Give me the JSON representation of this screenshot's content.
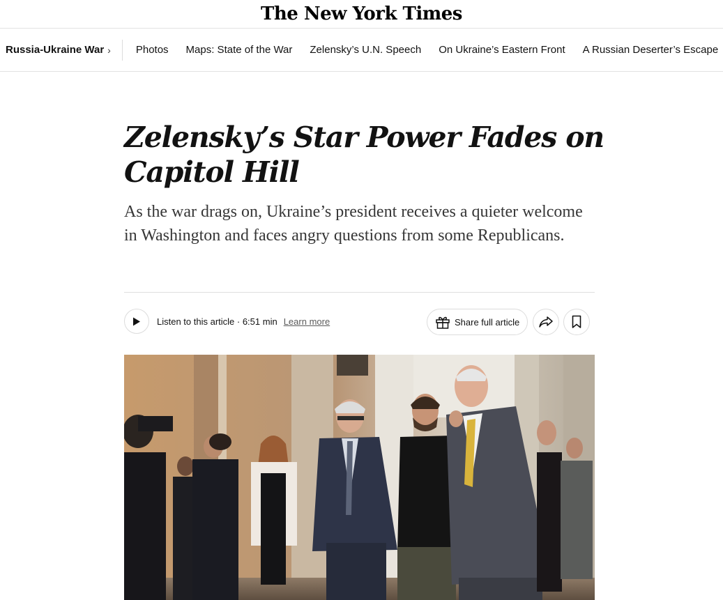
{
  "masthead": {
    "logo_text": "The New York Times"
  },
  "nav": {
    "section_label": "Russia-Ukraine War",
    "chevron": "›",
    "links": [
      "Photos",
      "Maps: State of the War",
      "Zelensky’s U.N. Speech",
      "On Ukraine’s Eastern Front",
      "A Russian Deserter’s Escape"
    ]
  },
  "article": {
    "headline": "Zelensky’s Star Power Fades on Capitol Hill",
    "summary": "As the war drags on, Ukraine’s president receives a quieter welcome in Washington and faces angry questions from some Republicans."
  },
  "toolbar": {
    "listen_label": "Listen to this article · 6:51 min",
    "learn_more": "Learn more",
    "share_full": "Share full article",
    "icons": [
      "play-icon",
      "gift-icon",
      "share-arrow-icon",
      "bookmark-icon"
    ]
  },
  "colors": {
    "text": "#121212",
    "border": "#dcdcdc",
    "muted": "#5a5a5a"
  }
}
